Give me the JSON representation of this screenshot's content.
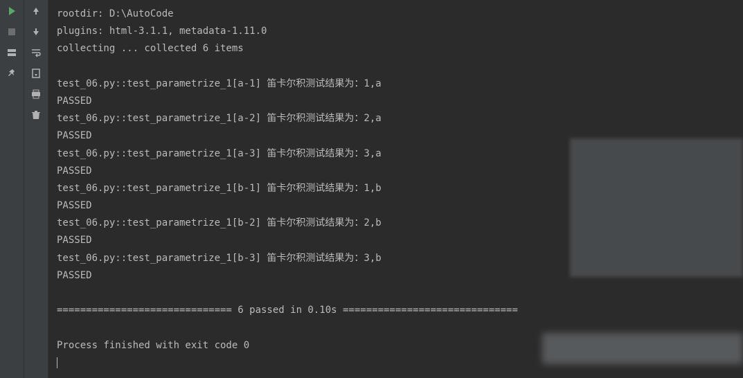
{
  "toolbar": {
    "run": "run-icon",
    "stop": "stop-icon",
    "layout": "layout-icon",
    "pin": "pin-icon"
  },
  "toolbar2": {
    "up": "up-icon",
    "down": "down-icon",
    "wrap": "wrap-icon",
    "export": "export-icon",
    "print": "print-icon",
    "delete": "delete-icon"
  },
  "console": {
    "rootdir": "rootdir: D:\\AutoCode",
    "plugins": "plugins: html-3.1.1, metadata-1.11.0",
    "collecting": "collecting ... collected 6 items",
    "blank1": "",
    "t1": "test_06.py::test_parametrize_1[a-1] 笛卡尔积测试结果为：1,a",
    "p1": "PASSED",
    "t2": "test_06.py::test_parametrize_1[a-2] 笛卡尔积测试结果为：2,a",
    "p2": "PASSED",
    "t3": "test_06.py::test_parametrize_1[a-3] 笛卡尔积测试结果为：3,a",
    "p3": "PASSED",
    "t4": "test_06.py::test_parametrize_1[b-1] 笛卡尔积测试结果为：1,b",
    "p4": "PASSED",
    "t5": "test_06.py::test_parametrize_1[b-2] 笛卡尔积测试结果为：2,b",
    "p5": "PASSED",
    "t6": "test_06.py::test_parametrize_1[b-3] 笛卡尔积测试结果为：3,b",
    "p6": "PASSED",
    "blank2": "",
    "summary": "============================== 6 passed in 0.10s ==============================",
    "blank3": "",
    "exit": "Process finished with exit code 0"
  }
}
